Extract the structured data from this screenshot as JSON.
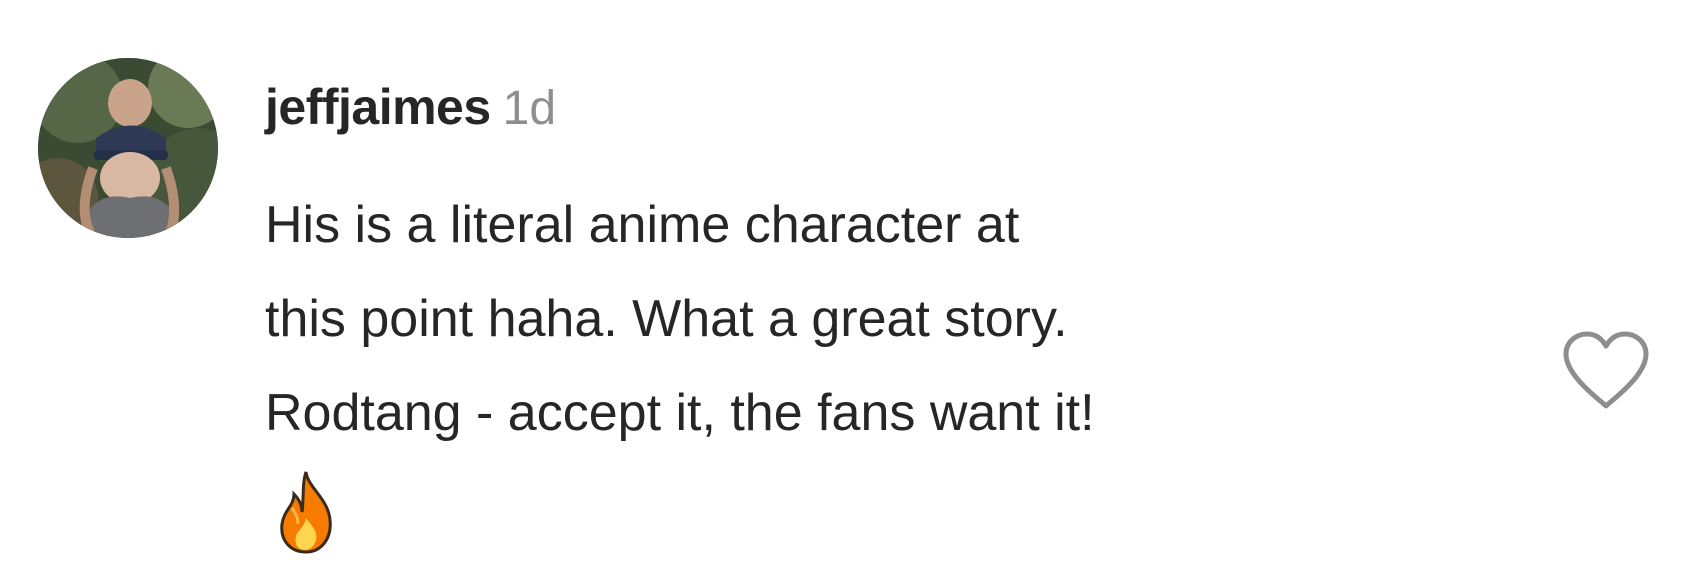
{
  "comment": {
    "username": "jeffjaimes",
    "timestamp": "1d",
    "text_lines": [
      "His is a literal anime character at",
      "this point haha. What a great story.",
      "Rodtang - accept it, the fans want it!"
    ],
    "emoji": "fire-emoji",
    "avatar_icon": "user-avatar",
    "like_icon": "heart-outline-icon"
  },
  "colors": {
    "text": "#262626",
    "timestamp": "#8e8e8e",
    "heart_stroke": "#8e8e8e",
    "fire_outer": "#f57c00",
    "fire_inner": "#ffd54f"
  }
}
